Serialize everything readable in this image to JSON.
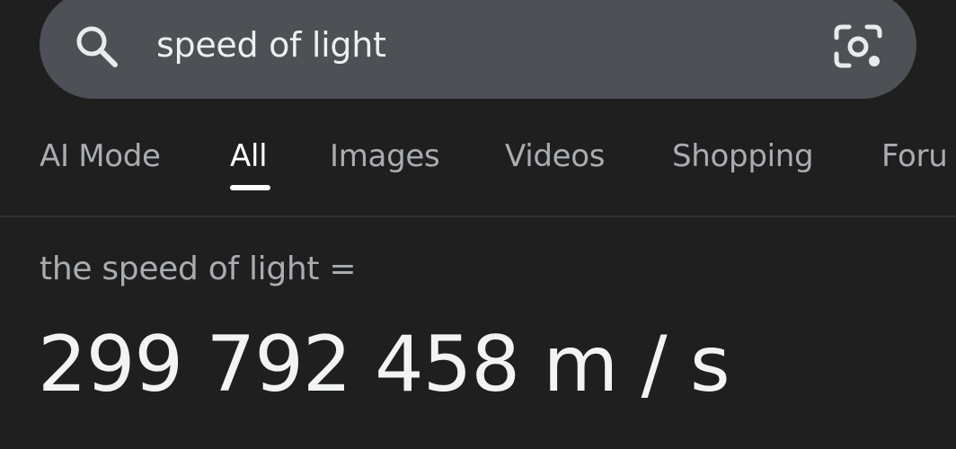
{
  "search": {
    "query": "speed of light",
    "search_icon": "search-icon",
    "lens_icon": "camera-lens-icon"
  },
  "tabs": [
    {
      "label": "AI Mode",
      "active": false
    },
    {
      "label": "All",
      "active": true
    },
    {
      "label": "Images",
      "active": false
    },
    {
      "label": "Videos",
      "active": false
    },
    {
      "label": "Shopping",
      "active": false
    },
    {
      "label": "Foru",
      "active": false
    }
  ],
  "answer": {
    "label": "the speed of light =",
    "value": "299 792 458 m / s"
  },
  "colors": {
    "background": "#1f1f1f",
    "search_bar": "#4d5055",
    "tab_inactive": "#a9adb2",
    "tab_active": "#ffffff",
    "answer_text": "#f1f3f4"
  }
}
